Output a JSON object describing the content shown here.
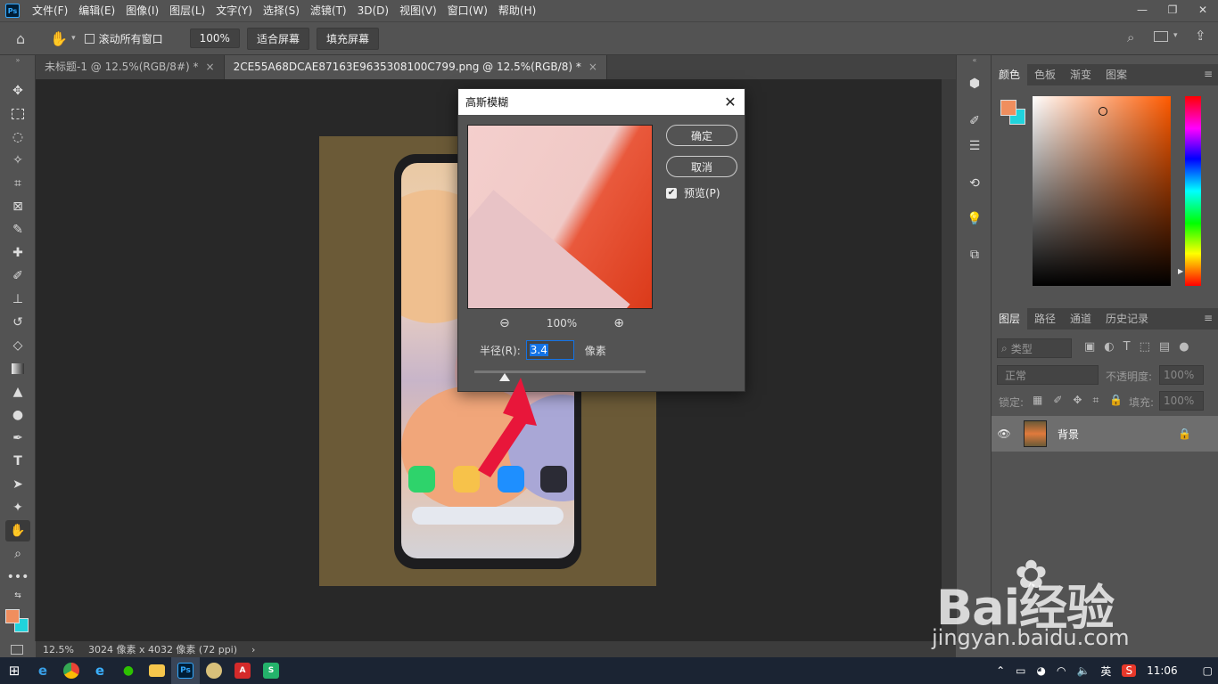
{
  "menubar": {
    "logo": "Ps",
    "items": [
      "文件(F)",
      "编辑(E)",
      "图像(I)",
      "图层(L)",
      "文字(Y)",
      "选择(S)",
      "滤镜(T)",
      "3D(D)",
      "视图(V)",
      "窗口(W)",
      "帮助(H)"
    ]
  },
  "options": {
    "scroll_all": "滚动所有窗口",
    "zoom": "100%",
    "fit_screen": "适合屏幕",
    "fill_screen": "填充屏幕"
  },
  "tabs": [
    {
      "label": "未标题-1 @ 12.5%(RGB/8#) *",
      "close": "×"
    },
    {
      "label": "2CE55A68DCAE87163E9635308100C799.png @ 12.5%(RGB/8) *",
      "close": "×"
    }
  ],
  "status": {
    "zoom": "12.5%",
    "dimensions": "3024 像素 x 4032 像素 (72 ppi)",
    "chevron": "›"
  },
  "dialog": {
    "title": "高斯模糊",
    "ok": "确定",
    "cancel": "取消",
    "preview_label": "预览(P)",
    "preview_checked": true,
    "preview_zoom": "100%",
    "radius_label": "半径(R):",
    "radius_value": "3.4",
    "radius_unit": "像素"
  },
  "color_panel": {
    "tabs": [
      "颜色",
      "色板",
      "渐变",
      "图案"
    ],
    "foreground": "#f08e5e",
    "background": "#20d3dc"
  },
  "layers_panel": {
    "tabs": [
      "图层",
      "路径",
      "通道",
      "历史记录"
    ],
    "filter_placeholder": "类型",
    "blend_mode": "正常",
    "opacity_label": "不透明度:",
    "opacity_value": "100%",
    "lock_label": "锁定:",
    "fill_label": "填充:",
    "fill_value": "100%",
    "layers": [
      {
        "name": "背景",
        "locked": true,
        "visible": true
      }
    ]
  },
  "taskbar": {
    "ime": "英",
    "time": "11:06"
  },
  "watermark": {
    "brand": "Bai经验",
    "url": "jingyan.baidu.com"
  }
}
